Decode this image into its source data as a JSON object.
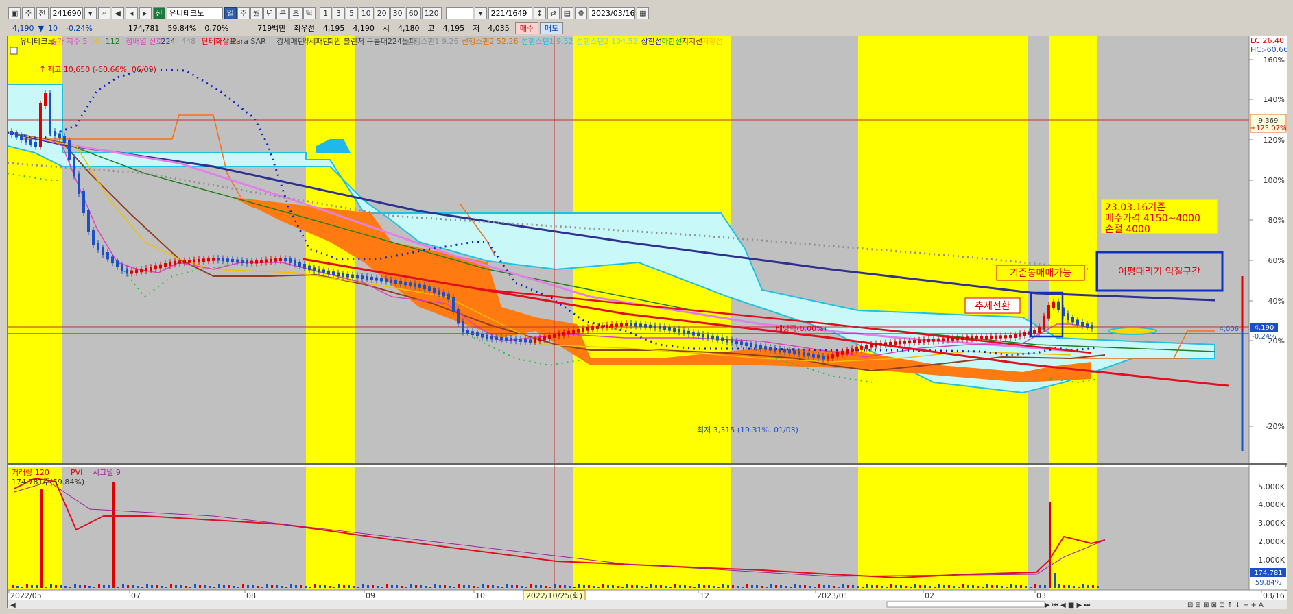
{
  "toolbar": {
    "mode_label": "주",
    "code_prefix": "전",
    "stock_code": "241690",
    "new_badge": "신",
    "stock_name": "유니테크노",
    "periods": [
      "일",
      "주",
      "월",
      "년",
      "분",
      "초",
      "틱"
    ],
    "intervals": [
      "1",
      "3",
      "5",
      "10",
      "20",
      "30",
      "60",
      "120"
    ],
    "range_label": "221/1649",
    "date": "2023/03/16"
  },
  "quote": {
    "price": "4,190",
    "change": "10",
    "change_pct": "-0.24%",
    "volume": "174,781",
    "volume_ratio": "59.84%",
    "turnover_pct": "0.70%",
    "trade_value": "719백만",
    "prev_label": "최우선",
    "ask": "4,195",
    "bid": "4,190",
    "open_label": "시",
    "open": "4,180",
    "high_label": "고",
    "high": "4,195",
    "low_label": "저",
    "low": "4,035",
    "buy_label": "매수",
    "sell_label": "매도"
  },
  "legend": [
    {
      "text": "유니테크노",
      "color": "#222222"
    },
    {
      "text": "종가 지수 5",
      "color": "#e040c0"
    },
    {
      "text": "20",
      "color": "#f0c000"
    },
    {
      "text": "112",
      "color": "#208020"
    },
    {
      "text": "정배열 신호",
      "color": "#e040c0"
    },
    {
      "text": "224",
      "color": "#303090"
    },
    {
      "text": "448",
      "color": "#909090"
    },
    {
      "text": "단테화살표",
      "color": "#e00000"
    },
    {
      "text": "Para SAR",
      "color": "#404040"
    },
    {
      "text": "강세패턴",
      "color": "#404040"
    },
    {
      "text": "약세패턴",
      "color": "#404040"
    },
    {
      "text": "회원 볼린저 구름대224돌파",
      "color": "#404040"
    },
    {
      "text": "선행스팬1 9.26",
      "color": "#909090"
    },
    {
      "text": "선행스팬2 52.26",
      "color": "#e07000"
    },
    {
      "text": "선행스팬1 9.52",
      "color": "#20c0e0"
    },
    {
      "text": "선행스팬2 104.52",
      "color": "#80d0e0"
    },
    {
      "text": "상한선",
      "color": "#2020c0"
    },
    {
      "text": "하한선",
      "color": "#20a020"
    },
    {
      "text": "지지선",
      "color": "#802020"
    },
    {
      "text": "저항선",
      "color": "#f0c000"
    }
  ],
  "axis": {
    "price_pct_ticks": [
      "160%",
      "140%",
      "120%",
      "100%",
      "80%",
      "60%",
      "40%",
      "20%",
      "-20%"
    ],
    "volume_ticks": [
      "5,000K",
      "4,000K",
      "3,000K",
      "2,000K",
      "1,000K"
    ],
    "x_ticks": [
      "2022/05",
      "07",
      "08",
      "09",
      "10",
      "12",
      "2023/01",
      "02",
      "03",
      "03/16"
    ],
    "cursor_date": "2022/10/25(화)",
    "lc": "LC:26.40",
    "hc": "HC:-60.66",
    "price_tag": "9,369",
    "price_tag_pct": "+123.07%",
    "current_price_tag": "4,190",
    "current_pct_tag": "-0.24%",
    "support_tag": "4,006",
    "vol_tag": "174,781",
    "vol_pct_tag": "59.84%"
  },
  "annotations": {
    "high_marker": "최고 10,650 (-60.66%, 06/09)",
    "low_marker": "최저 3,315 (19.31%, 01/03)",
    "dividend": "배당락(0.00%)",
    "trend": "추세전환",
    "base_candle": "기준봉매매가능",
    "note_line1": "23.03.16기준",
    "note_line2": "매수가격  4150~4000",
    "note_line3": "손절  4000",
    "profit_zone": "이평때리기  익절구간"
  },
  "volume_panel": {
    "legend_volume": "거래량 120",
    "legend_pvi": "PVI",
    "legend_signal": "시그널 9",
    "value": "174,781주(59.84%)"
  },
  "colors": {
    "yellow": "#ffff00",
    "gray": "#c0c0c0",
    "cloud": "#c8f8f8",
    "orange": "#ff7a10",
    "up": "#e00000",
    "down": "#1c50c8"
  }
}
